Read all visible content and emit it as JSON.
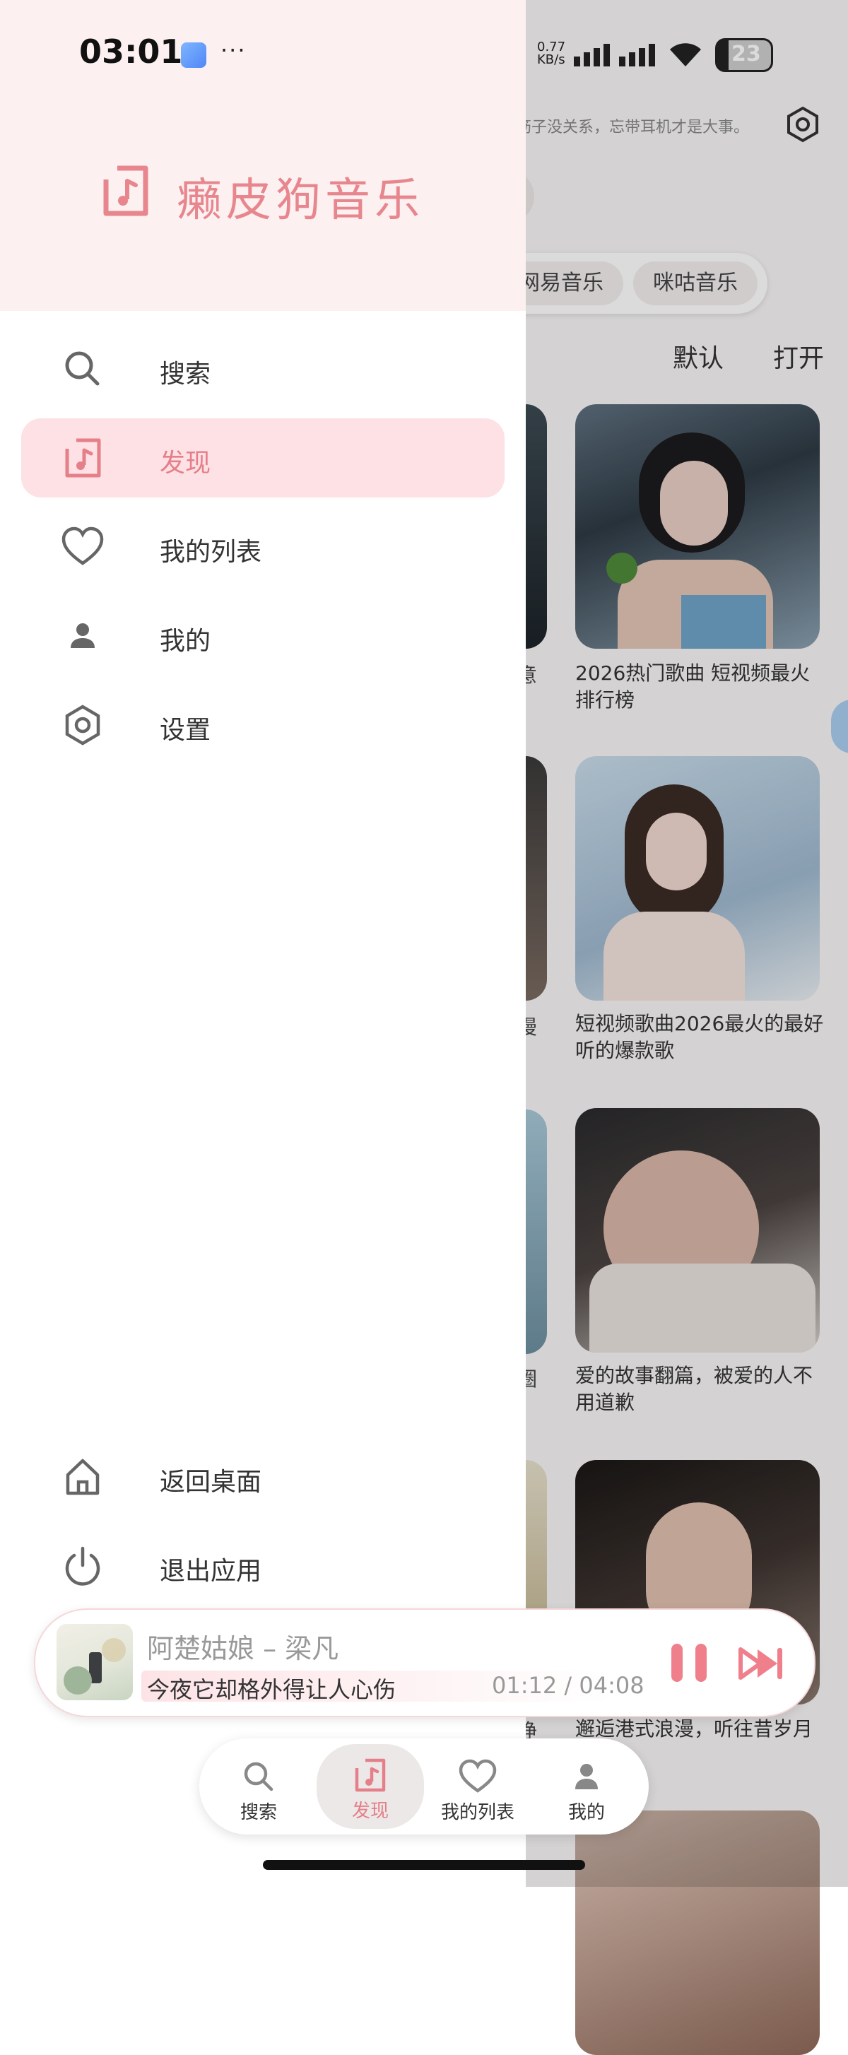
{
  "status_bar": {
    "time": "03:01",
    "dots": "···",
    "net_speed_top": "0.77",
    "net_speed_bottom": "KB/s",
    "battery": "23"
  },
  "background": {
    "tip": "筋子没关系，忘带耳机才是大事。",
    "chips": [
      "网易音乐",
      "咪咕音乐"
    ],
    "sort": [
      "默认",
      "打开"
    ],
    "left_captions": [
      "意",
      "漫",
      "圈",
      "睁"
    ],
    "cards": [
      {
        "title": "2026热门歌曲 短视频最火排行榜"
      },
      {
        "title": "短视频歌曲2026最火的最好听的爆款歌"
      },
      {
        "title": "爱的故事翻篇，被爱的人不用道歉"
      },
      {
        "title": "邂逅港式浪漫，听往昔岁月"
      }
    ]
  },
  "drawer": {
    "app_name": "癞皮狗音乐",
    "nav": [
      {
        "label": "搜索",
        "icon": "search-icon"
      },
      {
        "label": "发现",
        "icon": "music-note-icon",
        "active": true
      },
      {
        "label": "我的列表",
        "icon": "heart-icon"
      },
      {
        "label": "我的",
        "icon": "person-icon"
      },
      {
        "label": "设置",
        "icon": "settings-hexagon-icon"
      }
    ],
    "bottom": [
      {
        "label": "返回桌面",
        "icon": "home-icon"
      },
      {
        "label": "退出应用",
        "icon": "power-icon"
      }
    ]
  },
  "player": {
    "song": "阿楚姑娘 – 梁凡",
    "lyric": "今夜它却格外得让人心伤",
    "time": "01:12 / 04:08"
  },
  "tabs": [
    {
      "label": "搜索"
    },
    {
      "label": "发现",
      "active": true
    },
    {
      "label": "我的列表"
    },
    {
      "label": "我的"
    }
  ],
  "colors": {
    "accent": "#e8868e",
    "drawer_header": "#fcf0f1",
    "active_item": "#fde1e4"
  }
}
